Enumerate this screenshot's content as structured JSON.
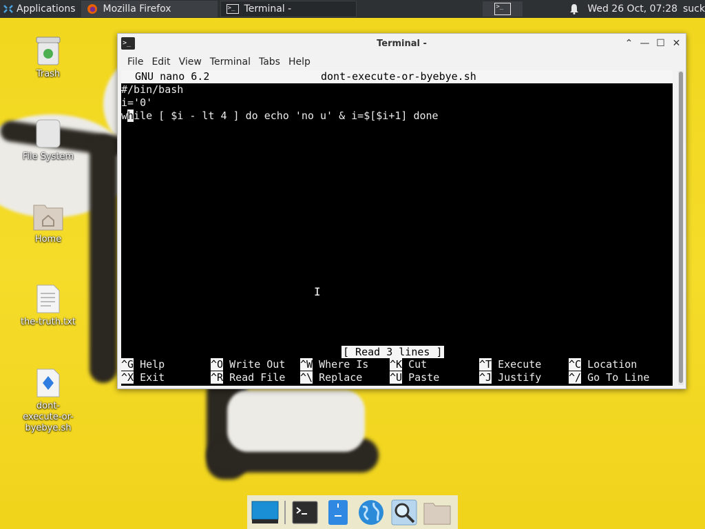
{
  "top_panel": {
    "apps_label": "Applications",
    "tasks": [
      {
        "label": "Mozilla Firefox"
      },
      {
        "label": "Terminal -"
      }
    ],
    "clock": "Wed 26 Oct, 07:28",
    "user": "suck"
  },
  "desktop": {
    "icons": [
      {
        "label": "Trash"
      },
      {
        "label": "File System"
      },
      {
        "label": "Home"
      },
      {
        "label": "the-truth.txt"
      },
      {
        "label": "dont-execute-or-byebye.sh"
      }
    ]
  },
  "window": {
    "title": "Terminal -",
    "menu": [
      "File",
      "Edit",
      "View",
      "Terminal",
      "Tabs",
      "Help"
    ]
  },
  "nano": {
    "version": "GNU nano 6.2",
    "filename": "dont-execute-or-byebye.sh",
    "lines": [
      "#/bin/bash",
      "i='0'",
      "while [ $i - lt 4 ] do echo 'no u' & i=$[$i+1] done"
    ],
    "cursor_char": "h",
    "line3_prefix": "w",
    "line3_suffix": "ile [ $i - lt 4 ] do echo 'no u' & i=$[$i+1] done",
    "status": "[ Read 3 lines ]",
    "shortcuts": [
      {
        "key": "^G",
        "label": "Help"
      },
      {
        "key": "^O",
        "label": "Write Out"
      },
      {
        "key": "^W",
        "label": "Where Is"
      },
      {
        "key": "^K",
        "label": "Cut"
      },
      {
        "key": "^T",
        "label": "Execute"
      },
      {
        "key": "^C",
        "label": "Location"
      },
      {
        "key": "^X",
        "label": "Exit"
      },
      {
        "key": "^R",
        "label": "Read File"
      },
      {
        "key": "^\\",
        "label": "Replace"
      },
      {
        "key": "^U",
        "label": "Paste"
      },
      {
        "key": "^J",
        "label": "Justify"
      },
      {
        "key": "^/",
        "label": "Go To Line"
      }
    ]
  },
  "colors": {
    "panel_bg": "#2e3134",
    "terminal_bg": "#000000",
    "wallpaper": "#f1d71e"
  }
}
